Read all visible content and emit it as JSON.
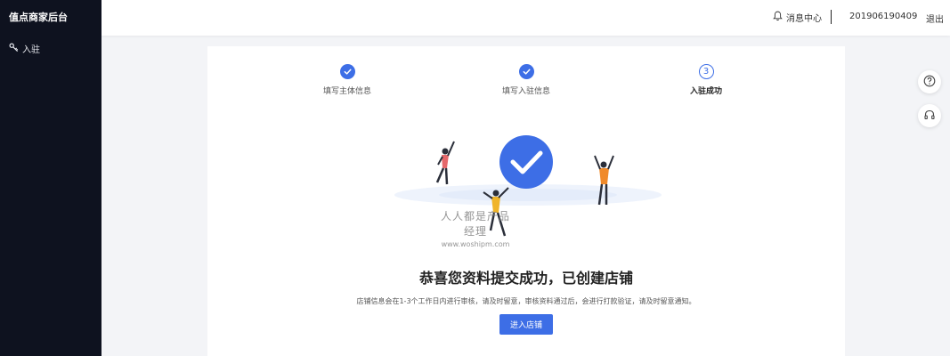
{
  "sidebar": {
    "brand": "值点商家后台",
    "items": [
      {
        "label": "入驻",
        "icon": "key-icon"
      }
    ]
  },
  "header": {
    "message_center": "消息中心",
    "message_icon": "bell-icon",
    "user_id": "201906190409",
    "logout": "退出"
  },
  "steps": [
    {
      "label": "填写主体信息",
      "status": "done"
    },
    {
      "label": "填写入驻信息",
      "status": "done"
    },
    {
      "label": "入驻成功",
      "status": "current",
      "number": "3"
    }
  ],
  "watermark": {
    "line1": "人人都是产品经理",
    "line2": "www.woshipm.com"
  },
  "result": {
    "title": "恭喜您资料提交成功，已创建店铺",
    "description": "店铺信息会在1-3个工作日内进行审核，请及时留意，审核资料通过后，会进行打款验证，请及时留意通知。",
    "button": "进入店铺"
  },
  "float_buttons": [
    {
      "icon": "help-circle-icon"
    },
    {
      "icon": "headset-icon"
    }
  ],
  "colors": {
    "accent": "#3d6ee6",
    "sidebar_bg": "#0e121f",
    "page_bg": "#f3f4f7"
  }
}
